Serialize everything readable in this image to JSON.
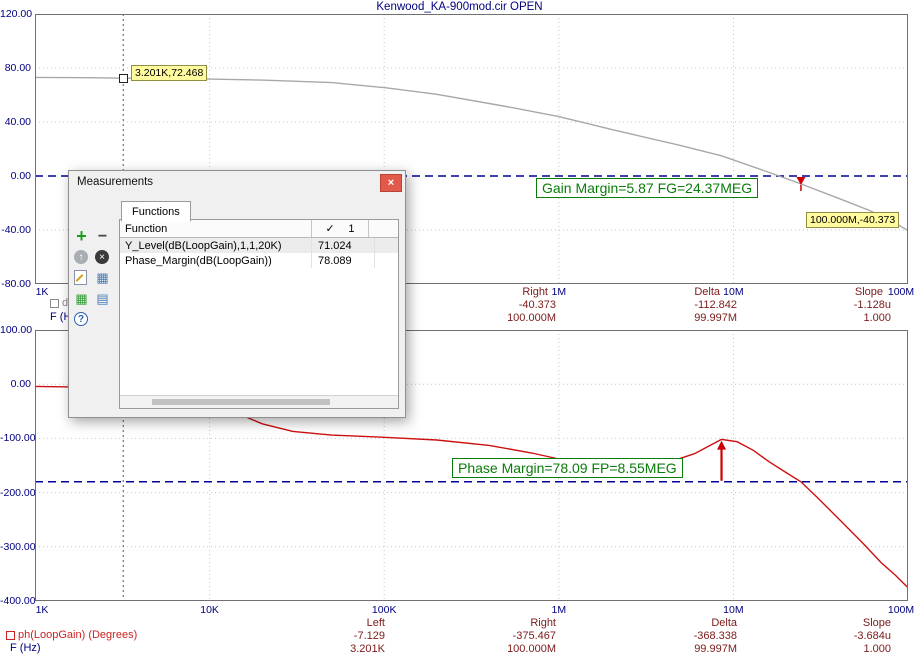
{
  "window": {
    "title": "Kenwood_KA-900mod.cir OPEN"
  },
  "dialog": {
    "title": "Measurements",
    "close_glyph": "×",
    "tab": "Functions",
    "toolbar_icons": [
      "add-icon",
      "remove-icon",
      "move-up-icon",
      "delete-icon",
      "edit-icon",
      "table-icon",
      "export-table-icon",
      "list-icon",
      "help-icon"
    ],
    "table": {
      "function_header": "Function",
      "check_glyph": "✓",
      "run_header": "1",
      "rows": [
        {
          "function": "Y_Level(dB(LoopGain),1,1,20K)",
          "value": "71.024"
        },
        {
          "function": "Phase_Margin(dB(LoopGain))",
          "value": "78.089"
        }
      ]
    }
  },
  "chart_data": [
    {
      "type": "line",
      "title": "Kenwood_KA-900mod.cir OPEN",
      "xlabel": "F (Hz)",
      "ylabel": "dB(LoopGain) (dB)",
      "x_scale": "log",
      "xlim": [
        1000,
        100000000
      ],
      "ylim": [
        -80,
        120
      ],
      "x_ticks": [
        "1K",
        "10K",
        "100K",
        "1M",
        "10M",
        "100M"
      ],
      "y_ticks": [
        "120.00",
        "80.00",
        "40.00",
        "0.00",
        "-40.00",
        "-80.00"
      ],
      "y_tick_values": [
        120,
        80,
        40,
        0,
        -40,
        -80
      ],
      "reference_line": 0,
      "cursor_x": 3201,
      "series": [
        {
          "name": "dB(LoopGain)",
          "color": "#a8a8a8",
          "points": [
            [
              1000,
              73
            ],
            [
              2000,
              72.8
            ],
            [
              3201,
              72.468
            ],
            [
              6000,
              72.2
            ],
            [
              10000,
              71.8
            ],
            [
              20000,
              71.024
            ],
            [
              50000,
              69.2
            ],
            [
              100000,
              65.5
            ],
            [
              200000,
              60.5
            ],
            [
              500000,
              51.5
            ],
            [
              1000000,
              44
            ],
            [
              2000000,
              34.5
            ],
            [
              5000000,
              22.5
            ],
            [
              8550000,
              15
            ],
            [
              15000000,
              4
            ],
            [
              24370000,
              -5.87
            ],
            [
              40000000,
              -16.5
            ],
            [
              60000000,
              -25.5
            ],
            [
              80000000,
              -33
            ],
            [
              100000000,
              -40.373
            ]
          ]
        }
      ],
      "annotations": [
        {
          "type": "point-label",
          "text": "3.201K,72.468",
          "x": 3201,
          "y": 72.468
        },
        {
          "type": "point-label",
          "text": "100.000M,-40.373",
          "x": 100000000,
          "y": -40.373
        },
        {
          "type": "callout",
          "text": "Gain Margin=5.87 FG=24.37MEG"
        },
        {
          "type": "marker",
          "x": 24370000,
          "y": 0
        }
      ],
      "cursor_readout": {
        "headers": [
          "Right",
          "Delta",
          "Slope"
        ],
        "rows": [
          [
            "-40.373",
            "-112.842",
            "-1.128u"
          ],
          [
            "100.000M",
            "99.997M",
            "1.000"
          ]
        ]
      }
    },
    {
      "type": "line",
      "xlabel": "F (Hz)",
      "ylabel": "ph(LoopGain) (Degrees)",
      "x_scale": "log",
      "xlim": [
        1000,
        100000000
      ],
      "ylim": [
        -400,
        100
      ],
      "x_ticks": [
        "1K",
        "10K",
        "100K",
        "1M",
        "10M",
        "100M"
      ],
      "y_ticks": [
        "100.00",
        "0.00",
        "-100.00",
        "-200.00",
        "-300.00",
        "-400.00"
      ],
      "y_tick_values": [
        100,
        0,
        -100,
        -200,
        -300,
        -400
      ],
      "reference_line": -180,
      "cursor_x": 3201,
      "series": [
        {
          "name": "ph(LoopGain)",
          "color": "#cc1111",
          "points": [
            [
              1000,
              -4
            ],
            [
              2000,
              -5.5
            ],
            [
              3201,
              -7.129
            ],
            [
              6000,
              -15
            ],
            [
              10000,
              -32
            ],
            [
              15000,
              -56
            ],
            [
              20000,
              -73
            ],
            [
              30000,
              -87
            ],
            [
              50000,
              -94
            ],
            [
              100000,
              -98
            ],
            [
              200000,
              -103
            ],
            [
              400000,
              -113
            ],
            [
              700000,
              -127
            ],
            [
              1000000,
              -138
            ],
            [
              1600000,
              -149
            ],
            [
              2500000,
              -155
            ],
            [
              4000000,
              -147
            ],
            [
              6000000,
              -128
            ],
            [
              8550000,
              -101.9
            ],
            [
              10500000,
              -106
            ],
            [
              13000000,
              -122
            ],
            [
              16000000,
              -143
            ],
            [
              20000000,
              -163
            ],
            [
              24370000,
              -180
            ],
            [
              30000000,
              -208
            ],
            [
              40000000,
              -248
            ],
            [
              55000000,
              -293
            ],
            [
              70000000,
              -329
            ],
            [
              85000000,
              -353
            ],
            [
              100000000,
              -375.467
            ]
          ]
        }
      ],
      "annotations": [
        {
          "type": "callout",
          "text": "Phase Margin=78.09 FP=8.55MEG"
        },
        {
          "type": "arrow",
          "x": 8550000,
          "from": -180,
          "to": -104
        }
      ],
      "cursor_readout": {
        "headers": [
          "Left",
          "Right",
          "Delta",
          "Slope"
        ],
        "rows": [
          [
            "-7.129",
            "-375.467",
            "-368.338",
            "-3.684u"
          ],
          [
            "3.201K",
            "100.000M",
            "99.997M",
            "1.000"
          ]
        ]
      }
    }
  ]
}
